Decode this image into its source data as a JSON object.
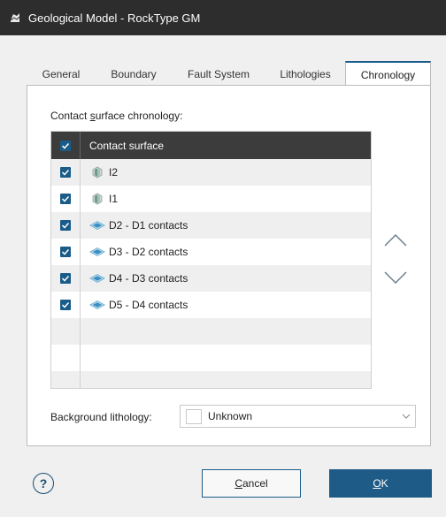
{
  "window": {
    "title": "Geological Model - RockType GM",
    "icon": "model-icon"
  },
  "tabs": [
    {
      "label": "General"
    },
    {
      "label": "Boundary"
    },
    {
      "label": "Fault System"
    },
    {
      "label": "Lithologies"
    },
    {
      "label": "Chronology",
      "active": true
    }
  ],
  "chronology": {
    "section_label_pre": "Contact ",
    "section_label_ul": "s",
    "section_label_post": "urface chronology:",
    "column_header": "Contact surface",
    "rows": [
      {
        "label": "I2",
        "checked": true,
        "icon": "intrusion-icon"
      },
      {
        "label": "I1",
        "checked": true,
        "icon": "intrusion-icon"
      },
      {
        "label": "D2 - D1 contacts",
        "checked": true,
        "icon": "deposit-icon"
      },
      {
        "label": "D3 - D2 contacts",
        "checked": true,
        "icon": "deposit-icon"
      },
      {
        "label": "D4 - D3 contacts",
        "checked": true,
        "icon": "deposit-icon"
      },
      {
        "label": "D5 - D4 contacts",
        "checked": true,
        "icon": "deposit-icon"
      }
    ],
    "move_up_icon": "chevron-up-icon",
    "move_down_icon": "chevron-down-icon"
  },
  "background": {
    "label_pre": "Back",
    "label_ul": "g",
    "label_post": "round lithology:",
    "value": "Unknown",
    "swatch_color": "#ffffff"
  },
  "footer": {
    "help_label": "?",
    "cancel_pre": "",
    "cancel_ul": "C",
    "cancel_post": "ancel",
    "ok_pre": "",
    "ok_ul": "O",
    "ok_post": "K"
  },
  "colors": {
    "accent": "#1a5c89",
    "header_bg": "#3c3c3c",
    "titlebar_bg": "#2d2d2d"
  }
}
